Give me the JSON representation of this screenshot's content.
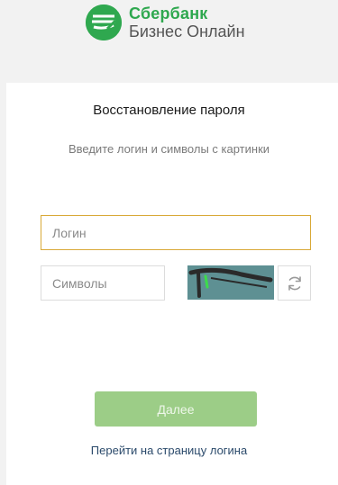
{
  "header": {
    "brand_name": "Сбербанк",
    "brand_sub": "Бизнес Онлайн",
    "logo_color": "#2fa84f"
  },
  "card": {
    "title": "Восстановление пароля",
    "subtitle": "Введите логин и символы с картинки",
    "login_placeholder": "Логин",
    "symbols_placeholder": "Символы",
    "captcha_icon": "captcha-image",
    "refresh_icon": "refresh-icon",
    "next_label": "Далее",
    "login_link_label": "Перейти на страницу логина"
  },
  "colors": {
    "accent_green": "#2fa84f",
    "button_disabled": "#9ccd87",
    "focus_border": "#d9a938",
    "link": "#2b4a6b"
  }
}
